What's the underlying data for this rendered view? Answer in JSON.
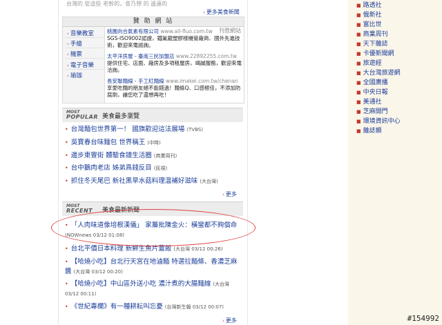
{
  "top": {
    "faded_text": "台灣的 從這些 老幹的，會乃想 的 遙遠的",
    "more_label": "更多美食新聞"
  },
  "sponsor": {
    "title": "贊 助 網 站",
    "tag": "刊登網站",
    "categories": [
      "音樂教室",
      "手繪",
      "機票",
      "電子音樂",
      "瑜珈"
    ],
    "ads": [
      {
        "title": "桃園向合氣素有限公司",
        "url": "www.all-fluo.com.tw",
        "body": "SGS-ISO9002認證，鐵氟龍塑膠樣機管廠商、國外先進技術，歡迎來電諮詢。"
      },
      {
        "title": "太平洋房屋 - 臺南三民加盟店",
        "url": "www.22892255.com.tw",
        "body": "提供住宅、店面、廠房及多項租屋房，竭誠服務，歡迎來電洽詢。"
      },
      {
        "title": "長安聯麵線 - 手工紅麵線",
        "url": "www.imakei.com.tw/chenan",
        "body": "享愛吃麵的朋友絕不能錯過！麵條Q、口感極佳，不添加防腐劑，讓您吃了還想再吃！"
      }
    ]
  },
  "popular": {
    "logo_top": "MOST",
    "logo_bottom": "POPULAR",
    "title": "美食最多瀏覽",
    "items": [
      {
        "title": "台灣麵包世界第一！ 國旗歡迎這法展場",
        "source": "(TVBS)"
      },
      {
        "title": "吳寶春台味麵包 世界稱王",
        "source": "(中時)"
      },
      {
        "title": "邊步東豐街 體驗食譜生活圈",
        "source": "(商業周刊)"
      },
      {
        "title": "台中鵝肉老店 姊弟爲錢反目",
        "source": "(民視)"
      },
      {
        "title": "抓住冬天尾巴 新社黑旱水菇料理溫補好滋味",
        "source": "(大台灣)"
      }
    ],
    "more_label": "更多"
  },
  "recent": {
    "logo_top": "MOST",
    "logo_bottom": "RECENT",
    "title": "美食最新新聞",
    "items": [
      {
        "title": "「人肉味道像培根漢儀」 家屬批陳金火：橫蠻都不夠償命",
        "source": "(NOWnews 03/12 01:08)"
      },
      {
        "title": "台北平價日本料理 新鮮生魚片蓋飯",
        "source": "(大台灣 03/12 00:26)"
      },
      {
        "title": "【哈燒小吃】台北行天宮在地滷麵 特選拉麵條、香濃芝麻醬",
        "source": "(大台灣 03/12 00:20)"
      },
      {
        "title": "【哈燒小吃】中山區外送小吃 濃汁煮的大腸麵線",
        "source": "(大台灣 03/12 00:11)"
      },
      {
        "title": "《世紀專欄》有一種耕耘叫忘憂",
        "source": "(台灣新生報 03/12 00:07)"
      }
    ],
    "more_label": "更多"
  },
  "rail": {
    "items": [
      "路透社",
      "俄新社",
      "富比世",
      "商業周刊",
      "天下雜誌",
      "卡優新聞網",
      "旅遊經",
      "大台灣旅遊網",
      "全國廣播",
      "中央日報",
      "美通社",
      "芝麻開門",
      "環境資訊中心",
      "雜誌類"
    ]
  },
  "watermark": "#154992"
}
